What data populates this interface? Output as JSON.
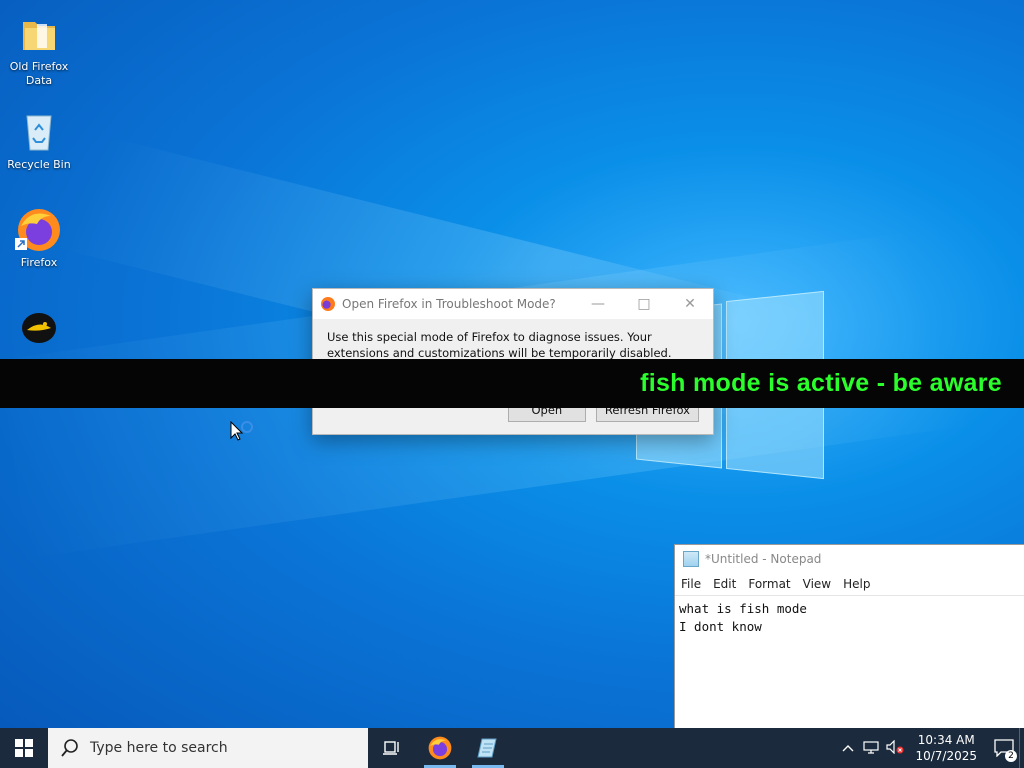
{
  "desktop": {
    "icons": [
      {
        "label": "Old Firefox Data"
      },
      {
        "label": "Recycle Bin"
      },
      {
        "label": "Firefox"
      },
      {
        "label": ""
      }
    ]
  },
  "dialog": {
    "title": "Open Firefox in Troubleshoot Mode?",
    "message": "Use this special mode of Firefox to diagnose issues. Your extensions and customizations will be temporarily disabled.",
    "open_label": "Open",
    "refresh_label": "Refresh Firefox"
  },
  "banner": {
    "text": "fish mode is active - be aware",
    "color": "#2bff2b"
  },
  "notepad": {
    "title": "*Untitled - Notepad",
    "menu": [
      "File",
      "Edit",
      "Format",
      "View",
      "Help"
    ],
    "line1": "what is fish mode",
    "line2": "I dont know"
  },
  "taskbar": {
    "search_placeholder": "Type here to search",
    "time": "10:34 AM",
    "date": "10/7/2025",
    "notification_count": "2"
  }
}
